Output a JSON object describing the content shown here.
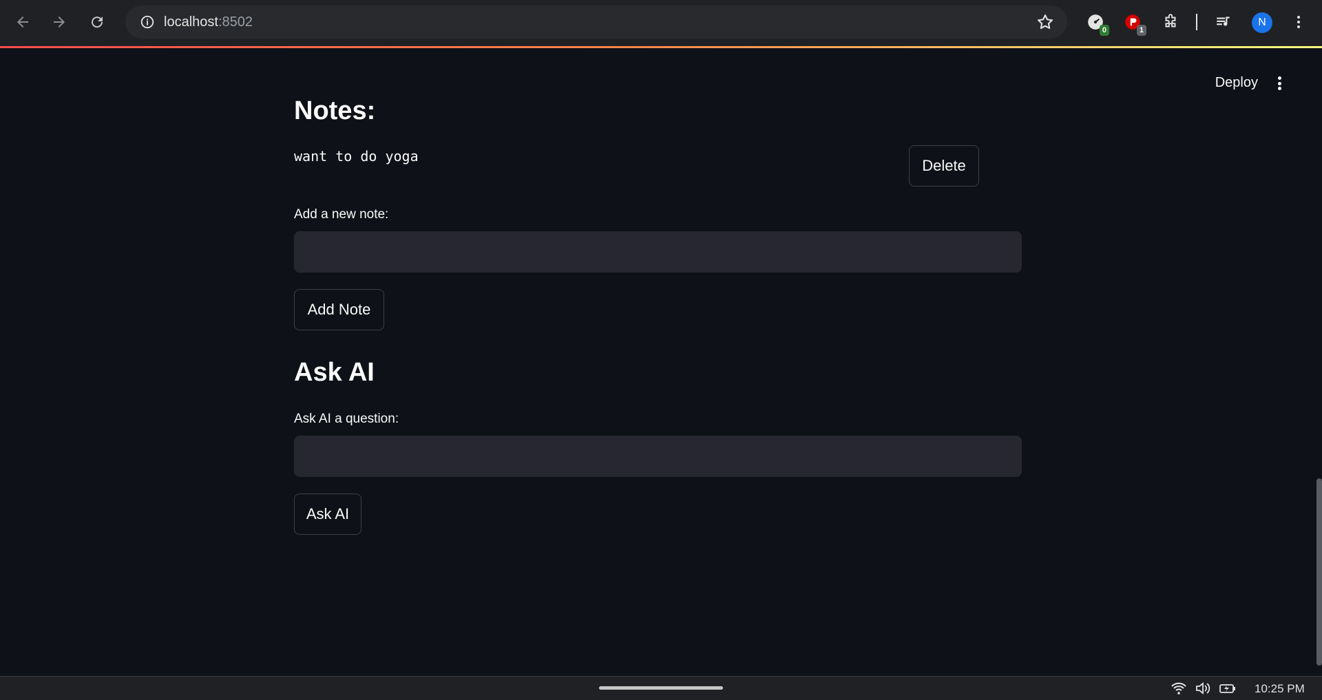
{
  "browser": {
    "url_host": "localhost",
    "url_port": ":8502",
    "extensions": [
      {
        "icon": "speedometer-extension-icon",
        "badge": "0",
        "badge_color": "#2e7d32"
      },
      {
        "icon": "red-extension-icon",
        "badge": "1",
        "badge_color": "#5f6368"
      }
    ],
    "profile_initial": "N"
  },
  "header": {
    "deploy_label": "Deploy"
  },
  "notes": {
    "heading": "Notes:",
    "items": [
      {
        "text": "want to do yoga",
        "delete_label": "Delete"
      }
    ],
    "add_label": "Add a new note:",
    "add_value": "",
    "add_button": "Add Note"
  },
  "ask_ai": {
    "heading": "Ask AI",
    "question_label": "Ask AI a question:",
    "question_value": "",
    "ask_button": "Ask AI"
  },
  "taskbar": {
    "time": "10:25 PM"
  },
  "colors": {
    "app_bg": "#0e1117",
    "input_bg": "#262730",
    "chrome_bg": "#202124",
    "accent_gradient_start": "#ff4b4b",
    "accent_gradient_end": "#fffd80"
  }
}
